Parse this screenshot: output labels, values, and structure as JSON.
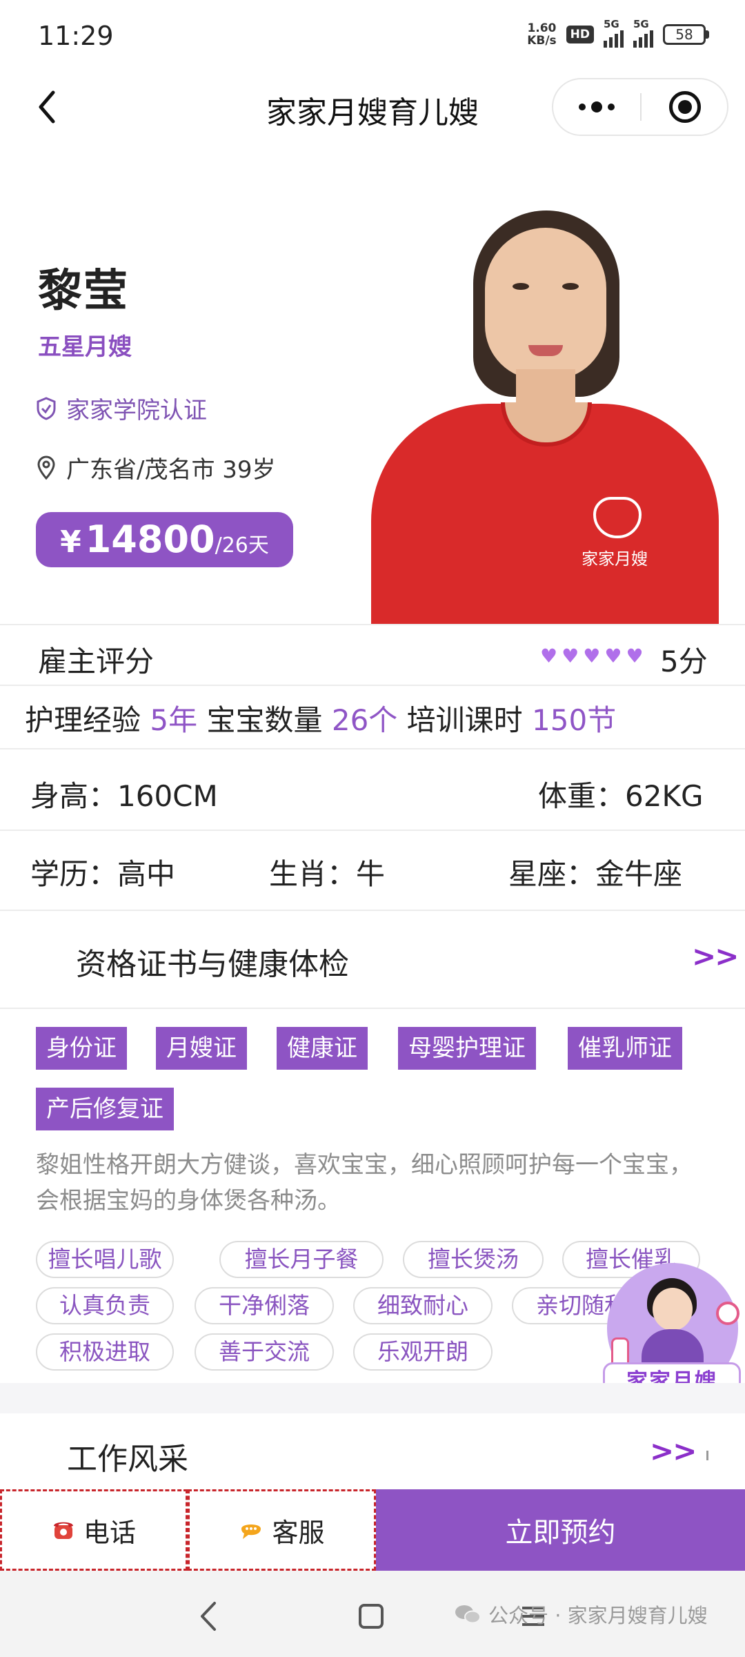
{
  "status_bar": {
    "time": "11:29",
    "net_speed_value": "1.60",
    "net_speed_unit": "KB/s",
    "hd_label": "HD",
    "network_1": "5G",
    "network_2": "5G",
    "battery": "58"
  },
  "nav": {
    "title": "家家月嫂育儿嫂"
  },
  "profile": {
    "name": "黎莹",
    "level": "五星月嫂",
    "certification": "家家学院认证",
    "location_age": "广东省/茂名市 39岁",
    "price_currency": "¥",
    "price_value": "14800",
    "price_unit": "/26天",
    "shirt_text": "家家月嫂"
  },
  "rating": {
    "label": "雇主评分",
    "hearts": 5,
    "score": "5分"
  },
  "experience": {
    "exp_label": "护理经验",
    "exp_value": "5年",
    "baby_label": "宝宝数量",
    "baby_value": "26个",
    "train_label": "培训课时",
    "train_value": "150节"
  },
  "body": {
    "height": "身高：160CM",
    "weight": "体重：62KG"
  },
  "info": {
    "education": "学历：高中",
    "zodiac": "生肖：牛",
    "constellation": "星座：金牛座"
  },
  "certificates": {
    "title": "资格证书与健康体检",
    "more": ">>",
    "items": [
      "身份证",
      "月嫂证",
      "健康证",
      "母婴护理证",
      "催乳师证",
      "产后修复证"
    ]
  },
  "description": "黎姐性格开朗大方健谈，喜欢宝宝，细心照顾呵护每一个宝宝，会根据宝妈的身体煲各种汤。",
  "skills": [
    "擅长唱儿歌",
    "擅长月子餐",
    "擅长煲汤",
    "擅长催乳",
    "认真负责",
    "干净俐落",
    "细致耐心",
    "亲切随和",
    "积极进取",
    "善于交流",
    "乐观开朗"
  ],
  "mascot_label": "家家月嫂",
  "work": {
    "title": "工作风采",
    "more": ">>"
  },
  "actions": {
    "phone": "电话",
    "service": "客服",
    "book": "立即预约"
  },
  "watermark": "公众号 · 家家月嫂育儿嫂",
  "colors": {
    "accent": "#8e54c4",
    "accent_text": "#8f55c6",
    "heart": "#b06fea"
  }
}
